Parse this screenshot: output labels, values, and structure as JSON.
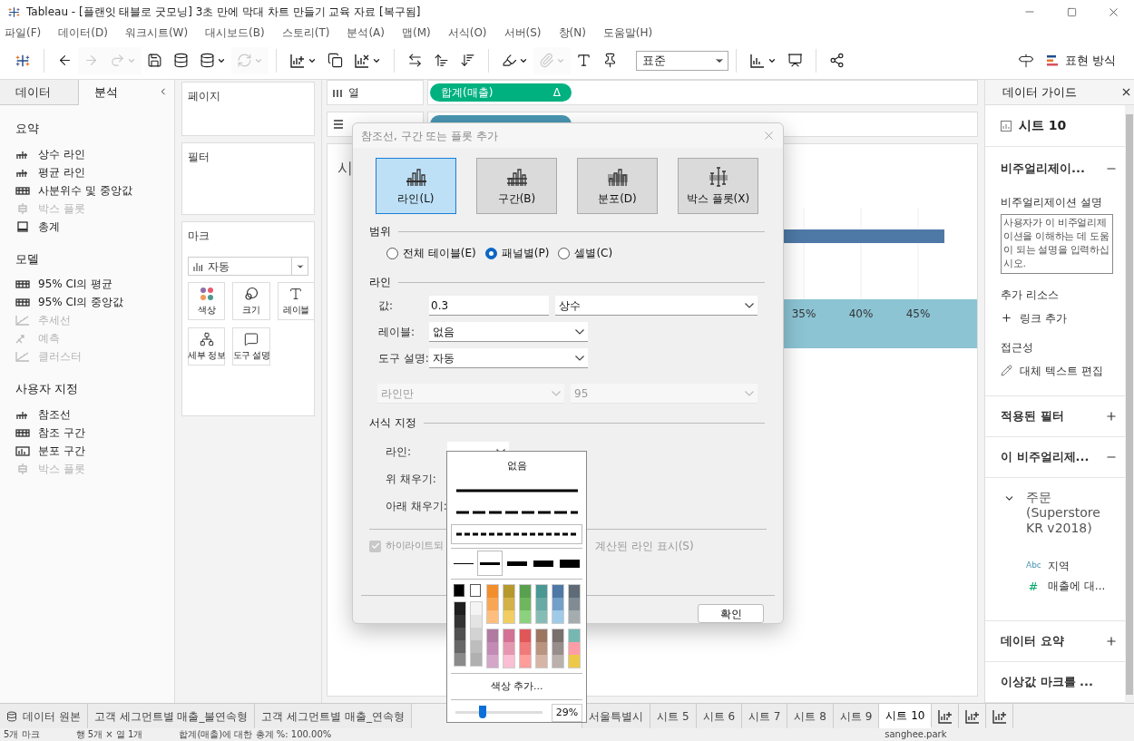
{
  "window": {
    "title": "Tableau - [플랜잇 태블로 굿모닝] 3초 만에 막대 차트 만들기 교육 자료 [복구됨]"
  },
  "menu": [
    "파일(F)",
    "데이터(D)",
    "워크시트(W)",
    "대시보드(B)",
    "스토리(T)",
    "분석(A)",
    "맵(M)",
    "서식(O)",
    "서버(S)",
    "창(N)",
    "도움말(H)"
  ],
  "toolbar": {
    "items": [
      {
        "kind": "logo"
      },
      {
        "kind": "sep"
      },
      {
        "kind": "back",
        "disabled": false,
        "caret": false
      },
      {
        "kind": "forward",
        "disabled": true,
        "caret": false
      },
      {
        "kind": "replay",
        "disabled": true,
        "caret": true
      },
      {
        "kind": "save",
        "disabled": false,
        "caret": false
      },
      {
        "kind": "datasource",
        "disabled": false,
        "caret": false
      },
      {
        "kind": "pause",
        "disabled": false,
        "caret": true
      },
      {
        "kind": "refresh",
        "disabled": true,
        "caret": true
      },
      {
        "kind": "sep"
      },
      {
        "kind": "new_sheet",
        "disabled": false,
        "caret": true
      },
      {
        "kind": "duplicate",
        "disabled": false,
        "caret": false
      },
      {
        "kind": "clear",
        "disabled": false,
        "caret": true
      },
      {
        "kind": "sep"
      },
      {
        "kind": "swap",
        "disabled": false,
        "caret": false
      },
      {
        "kind": "sort_asc",
        "disabled": false,
        "caret": false
      },
      {
        "kind": "sort_desc",
        "disabled": false,
        "caret": false
      },
      {
        "kind": "sep"
      },
      {
        "kind": "highlight",
        "disabled": false,
        "caret": true
      },
      {
        "kind": "group",
        "disabled": true,
        "caret": true
      },
      {
        "kind": "labels",
        "disabled": false,
        "caret": false
      },
      {
        "kind": "pin",
        "disabled": false,
        "caret": false
      },
      {
        "kind": "fit",
        "value": "표준"
      },
      {
        "kind": "sep"
      },
      {
        "kind": "chart",
        "disabled": false,
        "caret": true
      },
      {
        "kind": "present",
        "disabled": false,
        "caret": false
      },
      {
        "kind": "sep"
      },
      {
        "kind": "share",
        "disabled": false,
        "caret": false
      }
    ],
    "show_me": "표현 방식"
  },
  "left_panel": {
    "tabs": [
      {
        "label": "데이터",
        "selected": false
      },
      {
        "label": "분석",
        "selected": true
      }
    ],
    "sections": [
      {
        "title": "요약",
        "items": [
          {
            "label": "상수 라인",
            "kind": "line",
            "disabled": false
          },
          {
            "label": "평균 라인",
            "kind": "line",
            "disabled": false
          },
          {
            "label": "사분위수 및 중앙값",
            "kind": "band",
            "disabled": false
          },
          {
            "label": "박스 플롯",
            "kind": "box",
            "disabled": true
          },
          {
            "label": "총계",
            "kind": "total",
            "disabled": false
          }
        ]
      },
      {
        "title": "모델",
        "items": [
          {
            "label": "95% CI의 평균",
            "kind": "band",
            "disabled": false
          },
          {
            "label": "95% CI의 중앙값",
            "kind": "band",
            "disabled": false
          },
          {
            "label": "추세선",
            "kind": "trend",
            "disabled": true
          },
          {
            "label": "예측",
            "kind": "forecast",
            "disabled": true
          },
          {
            "label": "클러스터",
            "kind": "trend",
            "disabled": true
          }
        ]
      },
      {
        "title": "사용자 지정",
        "items": [
          {
            "label": "참조선",
            "kind": "line",
            "disabled": false
          },
          {
            "label": "참조 구간",
            "kind": "band",
            "disabled": false
          },
          {
            "label": "분포 구간",
            "kind": "distribution",
            "disabled": false
          },
          {
            "label": "박스 플롯",
            "kind": "box",
            "disabled": true
          }
        ]
      }
    ]
  },
  "cards": {
    "pages": "페이지",
    "filters": "필터",
    "marks": {
      "title": "마크",
      "mark_type": "자동",
      "buttons": [
        {
          "label": "색상",
          "kind": "color"
        },
        {
          "label": "크기",
          "kind": "size"
        },
        {
          "label": "레이블",
          "kind": "label"
        },
        {
          "label": "세부 정보",
          "kind": "detail"
        },
        {
          "label": "도구 설명",
          "kind": "tooltip"
        }
      ]
    }
  },
  "shelves": [
    {
      "label": "열",
      "kind": "columns",
      "pills": [
        {
          "label": "합계(매출)",
          "suffix": "Δ",
          "kind": "continuous"
        }
      ]
    },
    {
      "kind": "rows",
      "pills": [
        {
          "kind": "discrete"
        }
      ]
    }
  ],
  "sheet": {
    "title": "시",
    "axis_labels": [
      "35%",
      "40%",
      "45%"
    ]
  },
  "dialog": {
    "title": "참조선, 구간 또는 플롯 추가",
    "types": [
      {
        "label": "라인(L)",
        "kind": "line",
        "selected": true
      },
      {
        "label": "구간(B)",
        "kind": "band",
        "selected": false
      },
      {
        "label": "분포(D)",
        "kind": "distribution",
        "selected": false
      },
      {
        "label": "박스 플롯(X)",
        "kind": "box",
        "selected": false
      }
    ],
    "scope": {
      "title": "범위",
      "options": [
        {
          "label": "전체 테이블(E)",
          "selected": false
        },
        {
          "label": "패널별(P)",
          "selected": true
        },
        {
          "label": "셀별(C)",
          "selected": false
        }
      ]
    },
    "line": {
      "title": "라인",
      "value_label": "값:",
      "value": "0.3",
      "value_type": "상수",
      "label_label": "레이블:",
      "label_value": "없음",
      "tooltip_label": "도구 설명:",
      "tooltip_value": "자동",
      "extra_selects": [
        {
          "value": "라인만",
          "disabled": true
        },
        {
          "value": "95",
          "disabled": true
        }
      ]
    },
    "format": {
      "title": "서식 지정",
      "fields": [
        {
          "label": "라인:",
          "kind": "select"
        },
        {
          "label": "위 채우기:",
          "kind": "hidden"
        },
        {
          "label": "아래 채우기:",
          "kind": "hidden"
        }
      ]
    },
    "recalc": {
      "checked": true,
      "disabled": true,
      "label_start": "하이라이트되",
      "label_end": "계산된 라인 표시(S)"
    },
    "ok": "확인"
  },
  "format_popup": {
    "none_label": "없음",
    "line_styles": [
      {
        "kind": "solid",
        "selected": false
      },
      {
        "kind": "dashed",
        "selected": false
      },
      {
        "kind": "dotted",
        "selected": true
      }
    ],
    "widths": [
      {
        "selected": false
      },
      {
        "selected": true
      },
      {
        "selected": false
      },
      {
        "selected": false
      },
      {
        "selected": false
      }
    ],
    "palette": [
      {
        "kind": "gray",
        "swatches": [
          {
            "color": "#000000"
          },
          {
            "color": "#1f1f1f"
          },
          {
            "color": "#333333"
          },
          {
            "color": "#505050"
          },
          {
            "color": "#676767"
          },
          {
            "color": "#8a8a8a"
          }
        ]
      },
      {
        "kind": "gray",
        "swatches": [
          {
            "color": "#ffffff"
          },
          {
            "color": "#f4f4f4"
          },
          {
            "color": "#e4e4e4"
          },
          {
            "color": "#d3d3d3"
          },
          {
            "color": "#bdbdbd"
          },
          {
            "color": "#b0b0b0"
          }
        ]
      },
      {
        "kind": "hue",
        "swatches": [
          {
            "color": "#f28e2b"
          },
          {
            "color": "#f8a654"
          },
          {
            "color": "#ffbe7d"
          },
          {
            "color": "#b07aa1"
          },
          {
            "color": "#c28ab5"
          },
          {
            "color": "#d4a6c8"
          }
        ]
      },
      {
        "kind": "hue",
        "swatches": [
          {
            "color": "#b6992d"
          },
          {
            "color": "#d3b24a"
          },
          {
            "color": "#f1ce63"
          },
          {
            "color": "#d37295"
          },
          {
            "color": "#e597b0"
          },
          {
            "color": "#fabfd2"
          }
        ]
      },
      {
        "kind": "hue",
        "swatches": [
          {
            "color": "#59a14f"
          },
          {
            "color": "#6fb65f"
          },
          {
            "color": "#8cd17d"
          },
          {
            "color": "#e15759"
          },
          {
            "color": "#f07a7a"
          },
          {
            "color": "#ff9d9a"
          }
        ]
      },
      {
        "kind": "hue",
        "swatches": [
          {
            "color": "#499894"
          },
          {
            "color": "#68aaa5"
          },
          {
            "color": "#86bcb6"
          },
          {
            "color": "#9d7660"
          },
          {
            "color": "#b9957f"
          },
          {
            "color": "#d7b5a6"
          }
        ]
      },
      {
        "kind": "hue",
        "swatches": [
          {
            "color": "#4e79a7"
          },
          {
            "color": "#73a0c9"
          },
          {
            "color": "#a0cbe8"
          },
          {
            "color": "#79706e"
          },
          {
            "color": "#978e8b"
          },
          {
            "color": "#bab0ac"
          }
        ]
      },
      {
        "kind": "hue",
        "swatches": [
          {
            "color": "#5f6b77"
          },
          {
            "color": "#818b93"
          },
          {
            "color": "#a5acaf"
          },
          {
            "color": "#76b7b2"
          },
          {
            "color": "#ff9da7"
          },
          {
            "color": "#edc948"
          }
        ]
      }
    ],
    "more_colors": "색상 추가...",
    "opacity": {
      "level": 0.29,
      "reading": "29%"
    }
  },
  "data_guide": {
    "title": "데이터 가이드",
    "sheet": "시트 10",
    "viz_section": {
      "title": "비주얼리제이...",
      "expanded": true
    },
    "description_label": "비주얼리제이션 설명",
    "description_placeholder": "사용자가 이 비주얼리제이션을 이해하는 데 도움이 되는 설명을 입력하십시오.",
    "resources_label": "추가 리소스",
    "add_link": "링크 추가",
    "accessibility_label": "접근성",
    "alt_text": "대체 텍스트 편집",
    "sections": [
      {
        "title": "적용된 필터",
        "expanded": false
      },
      {
        "title": "이 비주얼리제...",
        "expanded": true
      }
    ],
    "tree": {
      "label": "주문 (Superstore KR v2018)",
      "expanded": true,
      "children": [
        {
          "badge": "Abc",
          "label": "지역",
          "kind": "dimension"
        },
        {
          "badge": "#",
          "label": "매출에 대...",
          "kind": "measure"
        }
      ]
    },
    "bottom_sections": [
      {
        "title": "데이터 요약",
        "expanded": false
      },
      {
        "title": "이상값 마크를 ..."
      }
    ]
  },
  "sheet_tabs": [
    {
      "label": "데이터 원본",
      "kind": "datasource",
      "selected": false
    },
    {
      "label": "고객 세그먼트별 매출_불연속형",
      "kind": "sheet",
      "selected": false
    },
    {
      "label": "고객 세그먼트별 매출_연속형",
      "kind": "sheet",
      "selected": false
    },
    {
      "kind": "covered",
      "selected": false
    },
    {
      "label": "서울특별시",
      "kind": "sheet",
      "selected": false
    },
    {
      "label": "시트 5",
      "kind": "sheet",
      "selected": false
    },
    {
      "label": "시트 6",
      "kind": "sheet",
      "selected": false
    },
    {
      "label": "시트 7",
      "kind": "sheet",
      "selected": false
    },
    {
      "label": "시트 8",
      "kind": "sheet",
      "selected": false
    },
    {
      "label": "시트 9",
      "kind": "sheet",
      "selected": false
    },
    {
      "label": "시트 10",
      "kind": "sheet",
      "selected": true
    }
  ],
  "status_bar": {
    "marks": "5개 마크",
    "dims": "행 5개 × 열 1개",
    "total": "합계(매출)에 대한 총계 %: 100.00%",
    "user": "sanghee.park"
  }
}
